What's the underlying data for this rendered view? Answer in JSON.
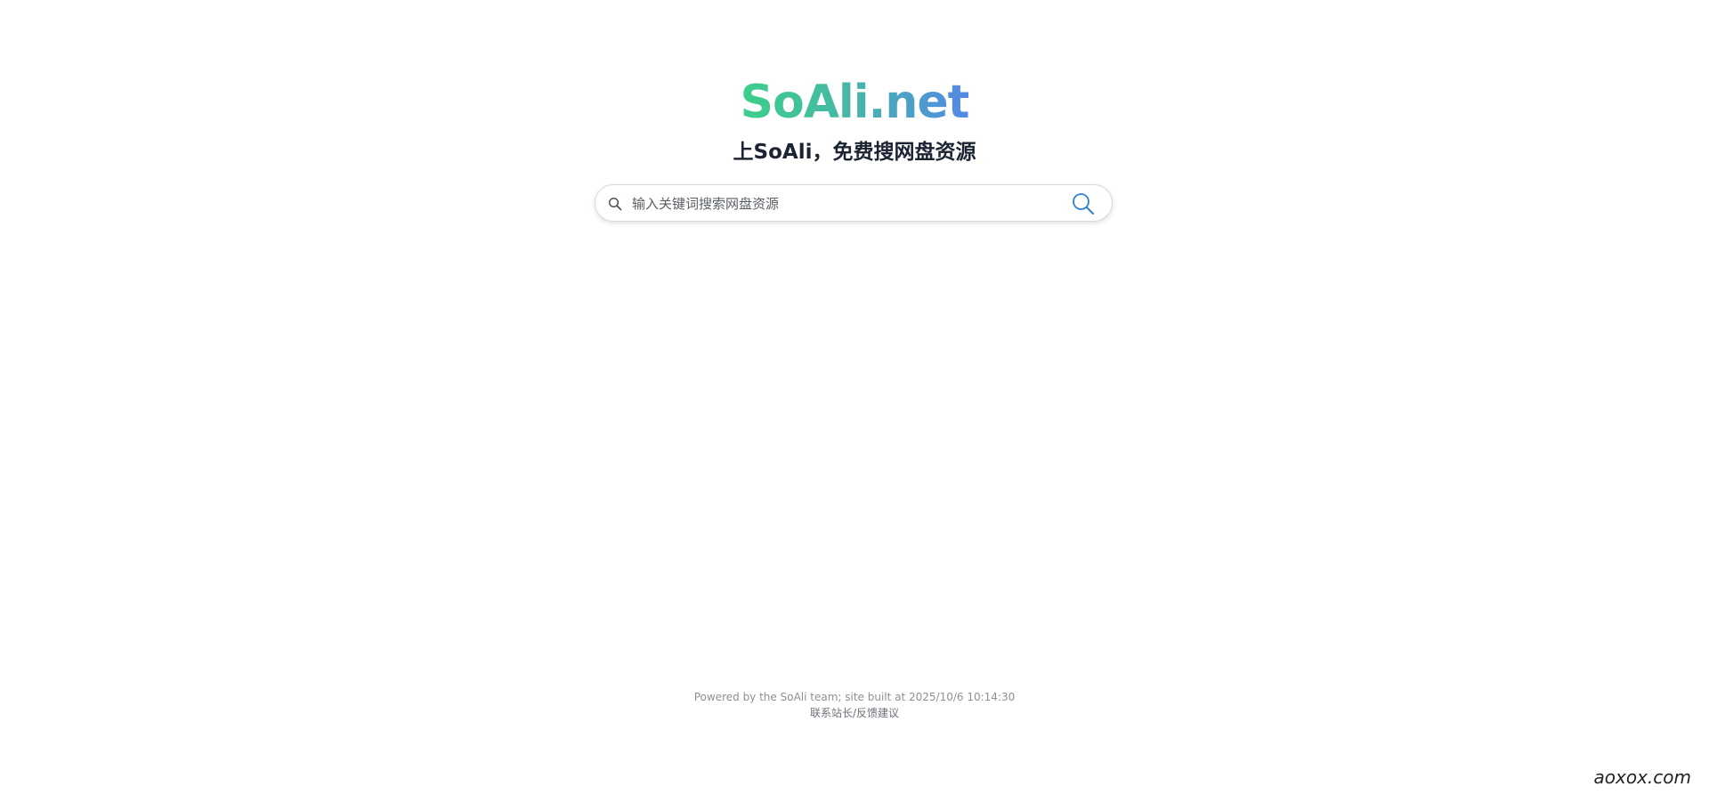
{
  "header": {
    "logo_text": "SoAli.net",
    "slogan": "上SoAli，免费搜网盘资源"
  },
  "search": {
    "placeholder": "输入关键词搜索网盘资源",
    "value": "",
    "leading_icon": "search-icon",
    "button_icon": "search-icon"
  },
  "footer": {
    "powered_by": "Powered by the SoAli team; site built at 2025/10/6 10:14:30",
    "contact_link": "联系站长/反馈建议"
  },
  "watermark": {
    "text": "aoxox.com"
  },
  "colors": {
    "logo_gradient_start": "#3ccf8a",
    "logo_gradient_end": "#5389e6",
    "slogan": "#1c2433",
    "search_button_icon": "#2f7fd1"
  }
}
